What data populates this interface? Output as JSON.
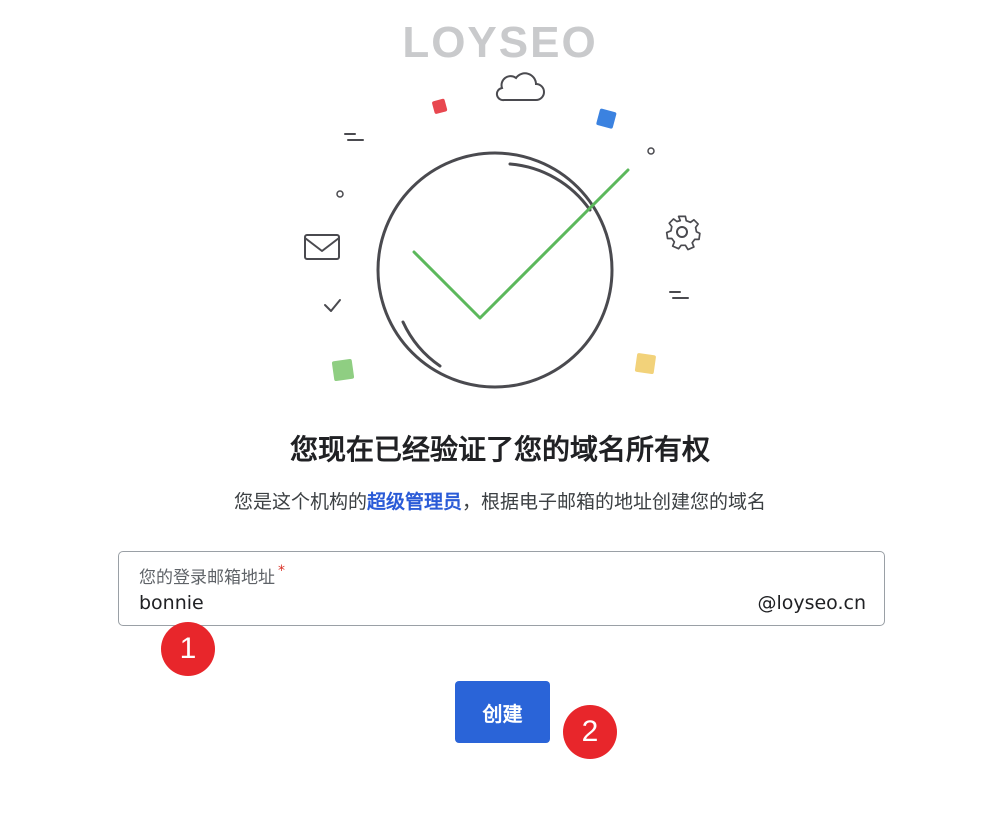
{
  "watermark": {
    "text": "LOYSEO"
  },
  "header": {
    "title": "您现在已经验证了您的域名所有权",
    "subtitle_prefix": "您是这个机构的",
    "subtitle_highlight": "超级管理员",
    "subtitle_suffix": "，根据电子邮箱的地址创建您的域名"
  },
  "email_field": {
    "label": "您的登录邮箱地址",
    "required_mark": "*",
    "value": "bonnie",
    "domain_suffix": "@loyseo.cn"
  },
  "create_button": {
    "label": "创建"
  },
  "markers": {
    "one": "1",
    "two": "2"
  },
  "colors": {
    "check": "#5cb85c",
    "accent": "#2a64d8",
    "highlight": "#2a5bd7",
    "marker": "#e8262b",
    "confetti_red": "#e8474f",
    "confetti_blue": "#3b82e0",
    "confetti_green": "#8fce82",
    "confetti_yellow": "#f2d27a"
  },
  "icons": [
    "cloud-icon",
    "envelope-icon",
    "gear-icon",
    "checkmark-icon",
    "small-check-icon"
  ]
}
